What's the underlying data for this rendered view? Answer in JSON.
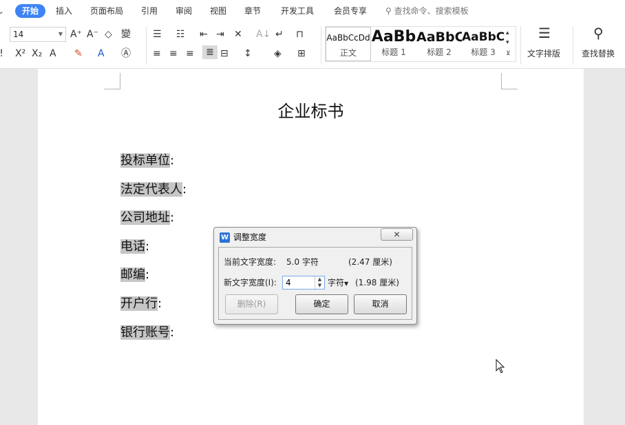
{
  "menubar": {
    "tabs": [
      "开始",
      "插入",
      "页面布局",
      "引用",
      "审阅",
      "视图",
      "章节",
      "开发工具",
      "会员专享"
    ],
    "search_placeholder": "查找命令、搜索模板"
  },
  "ribbon": {
    "font_size": "14",
    "styles": [
      {
        "sample": "AaBbCcDd",
        "label": "正文"
      },
      {
        "sample": "AaBb",
        "label": "标题 1"
      },
      {
        "sample": "AaBbC",
        "label": "标题 2"
      },
      {
        "sample": "AaBbCc",
        "label": "标题 3"
      }
    ],
    "text_layout_label": "文字排版",
    "find_replace_label": "查找替换"
  },
  "document": {
    "title": "企业标书",
    "lines": [
      {
        "label": "投标单位",
        "colon": ":"
      },
      {
        "label": "法定代表人",
        "colon": ":"
      },
      {
        "label": "公司地址",
        "colon": ":"
      },
      {
        "label": "电话",
        "colon": ":"
      },
      {
        "label": "邮编",
        "colon": ":"
      },
      {
        "label": "开户行",
        "colon": ":"
      },
      {
        "label": "银行账号",
        "colon": ":"
      }
    ]
  },
  "dialog": {
    "logo": "W",
    "title": "调整宽度",
    "current_width_label": "当前文字宽度:",
    "current_width_value": "5.0 字符",
    "current_width_cm": "(2.47 厘米)",
    "new_width_label": "新文字宽度(I):",
    "new_width_value": "4",
    "unit": "字符",
    "new_width_cm": "(1.98 厘米)",
    "delete_label": "删除(R)",
    "ok_label": "确定",
    "cancel_label": "取消"
  }
}
